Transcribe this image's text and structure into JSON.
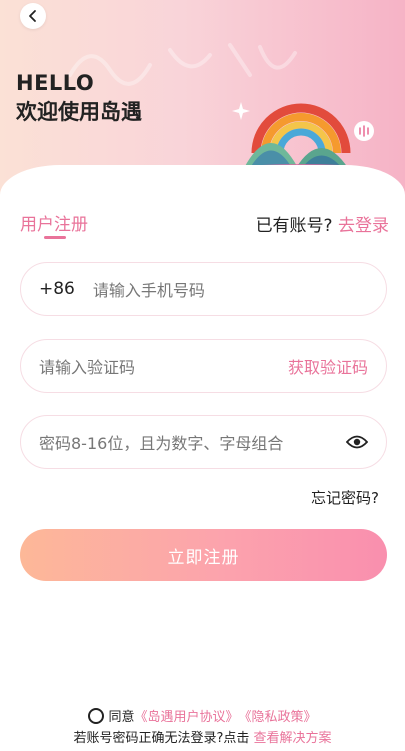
{
  "header": {
    "hello": "HELLO",
    "welcome": "欢迎使用岛遇"
  },
  "tabs": {
    "register": "用户注册",
    "have_account": "已有账号?",
    "login_link": "去登录"
  },
  "phone": {
    "prefix": "+86",
    "placeholder": "请输入手机号码"
  },
  "code": {
    "placeholder": "请输入验证码",
    "get_code": "获取验证码"
  },
  "password": {
    "placeholder": "密码8-16位，且为数字、字母组合"
  },
  "forgot": "忘记密码?",
  "submit": "立即注册",
  "agreement": {
    "agree": "同意",
    "user_agreement": "《岛遇用户协议》",
    "privacy": "《隐私政策》"
  },
  "help": {
    "text": "若账号密码正确无法登录?点击",
    "link": "查看解决方案"
  },
  "colors": {
    "accent": "#e9739a",
    "button_start": "#fdb898",
    "button_end": "#f98fae"
  },
  "icons": [
    "back-chevron-icon",
    "rainbow-island-illustration",
    "sparkle-icon",
    "eye-icon",
    "radio-unchecked-icon"
  ]
}
